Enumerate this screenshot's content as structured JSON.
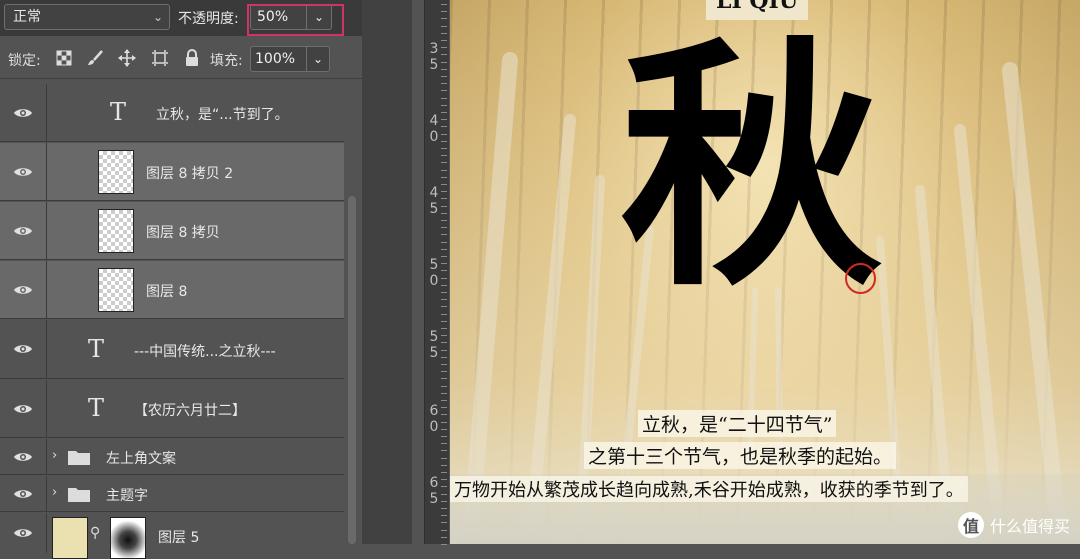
{
  "toolbar": {
    "blend_mode": "正常",
    "opacity_label": "不透明度:",
    "opacity_value": "50%",
    "lock_label": "锁定:",
    "fill_label": "填充:",
    "fill_value": "100%"
  },
  "layers": [
    {
      "name": "立秋，是“...节到了。",
      "type": "text"
    },
    {
      "name": "图层 8 拷贝 2",
      "type": "pixel",
      "selected": true
    },
    {
      "name": "图层 8 拷贝",
      "type": "pixel",
      "selected": true
    },
    {
      "name": "图层 8",
      "type": "pixel",
      "selected": true
    },
    {
      "name": "---中国传统...之立秋---",
      "type": "text"
    },
    {
      "name": "【农历六月廿二】",
      "type": "text"
    },
    {
      "name": "左上角文案",
      "type": "group"
    },
    {
      "name": "主题字",
      "type": "group"
    },
    {
      "name": "图层 5",
      "type": "pixel"
    }
  ],
  "ruler": {
    "labels": [
      {
        "a": "3",
        "b": "5"
      },
      {
        "a": "4",
        "b": "0"
      },
      {
        "a": "4",
        "b": "5"
      },
      {
        "a": "5",
        "b": "0"
      },
      {
        "a": "5",
        "b": "5"
      },
      {
        "a": "6",
        "b": "0"
      },
      {
        "a": "6",
        "b": "5"
      }
    ]
  },
  "canvas": {
    "top_label": "LI QIU",
    "big_char": "秋",
    "line1": "立秋，是“二十四节气”",
    "line2": "之第十三个节气，也是秋季的起始。",
    "line3": "万物开始从繁茂成长趋向成熟,禾谷开始成熟，收获的季节到了。",
    "watermark": "什么值得买",
    "watermark_icon": "值"
  },
  "colors": {
    "highlight_box": "#d0336c",
    "marker_circle": "#d12828",
    "panel_bg": "#535353",
    "selected_layer_bg": "#696969"
  }
}
